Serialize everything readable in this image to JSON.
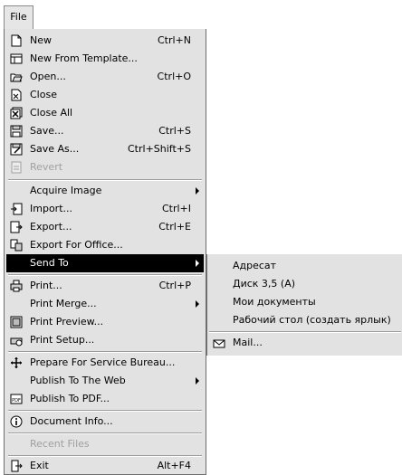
{
  "menubar": {
    "file": "File"
  },
  "file_menu": {
    "new": {
      "label": "New",
      "shortcut": "Ctrl+N"
    },
    "new_from_template": {
      "label": "New From Template..."
    },
    "open": {
      "label": "Open...",
      "shortcut": "Ctrl+O"
    },
    "close": {
      "label": "Close"
    },
    "close_all": {
      "label": "Close All"
    },
    "save": {
      "label": "Save...",
      "shortcut": "Ctrl+S"
    },
    "save_as": {
      "label": "Save As...",
      "shortcut": "Ctrl+Shift+S"
    },
    "revert": {
      "label": "Revert"
    },
    "acquire_image": {
      "label": "Acquire Image"
    },
    "import": {
      "label": "Import...",
      "shortcut": "Ctrl+I"
    },
    "export": {
      "label": "Export...",
      "shortcut": "Ctrl+E"
    },
    "export_office": {
      "label": "Export For Office..."
    },
    "send_to": {
      "label": "Send To"
    },
    "print": {
      "label": "Print...",
      "shortcut": "Ctrl+P"
    },
    "print_merge": {
      "label": "Print Merge..."
    },
    "print_preview": {
      "label": "Print Preview..."
    },
    "print_setup": {
      "label": "Print Setup..."
    },
    "prepare_service_bureau": {
      "label": "Prepare For Service Bureau..."
    },
    "publish_web": {
      "label": "Publish To The Web"
    },
    "publish_pdf": {
      "label": "Publish To PDF..."
    },
    "document_info": {
      "label": "Document Info..."
    },
    "recent_files": {
      "label": "Recent Files"
    },
    "exit": {
      "label": "Exit",
      "shortcut": "Alt+F4"
    }
  },
  "send_to_menu": {
    "items": [
      "Адресат",
      "Диск 3,5 (A)",
      "Мои документы",
      "Рабочий стол (создать ярлык)"
    ],
    "mail": "Mail..."
  }
}
